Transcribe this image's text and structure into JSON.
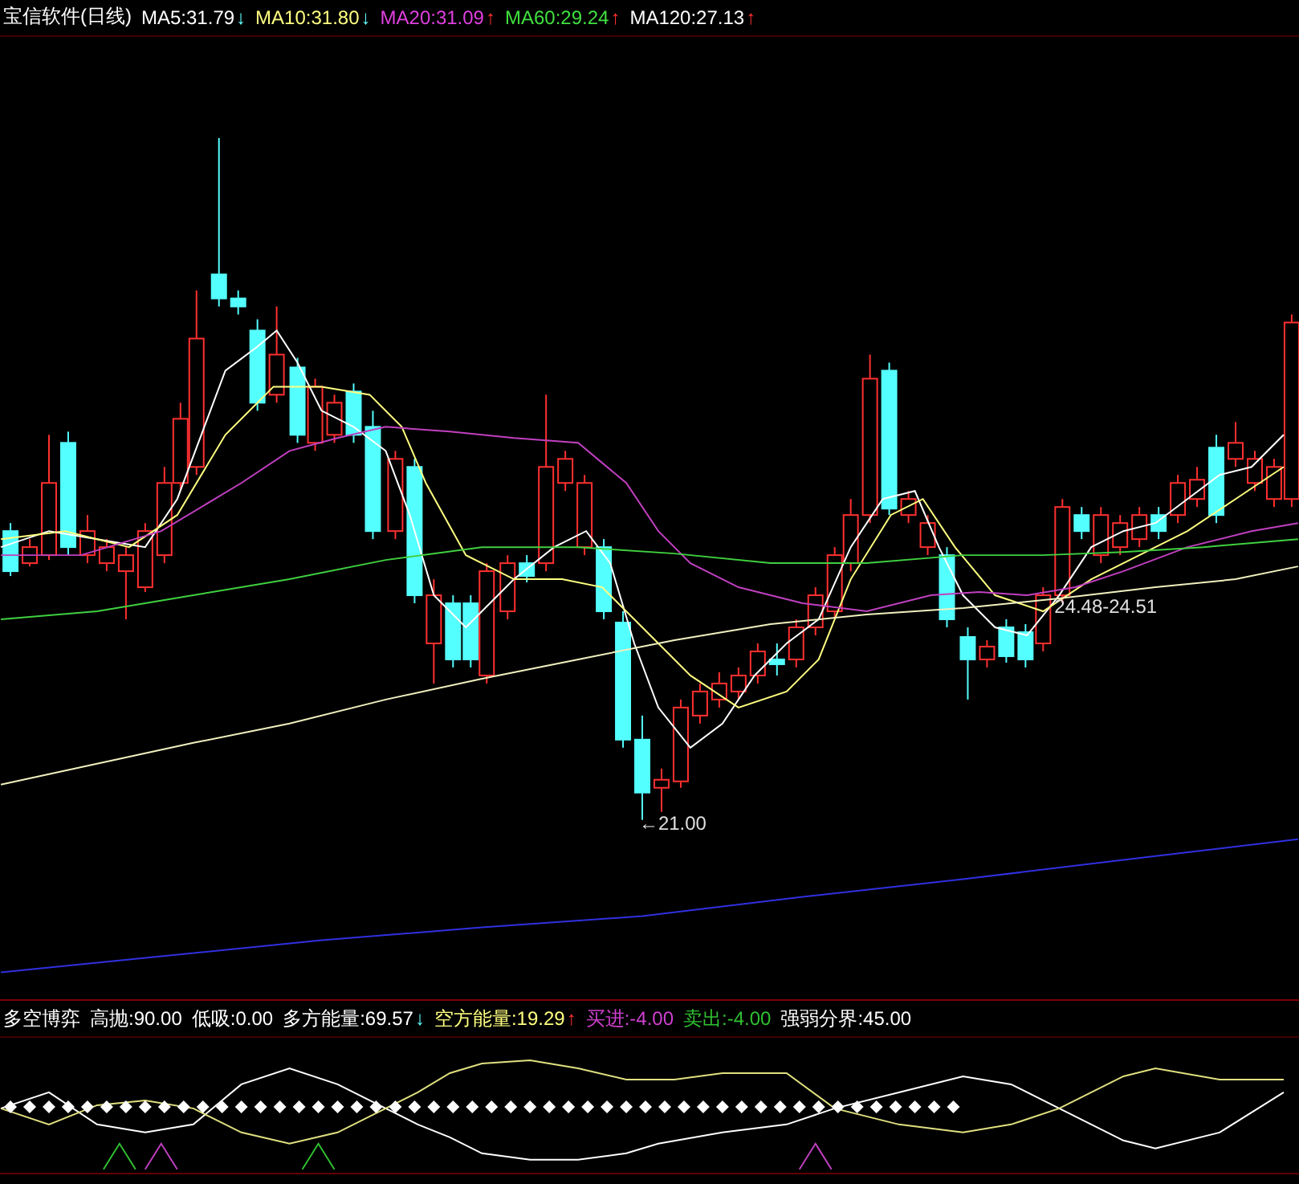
{
  "chart_header": {
    "title": "宝信软件(日线)",
    "indicators": [
      {
        "label": "MA5:31.79",
        "color": "#ffffff",
        "arrow": "↓",
        "rising": false
      },
      {
        "label": "MA10:31.80",
        "color": "#ffff80",
        "arrow": "↓",
        "rising": false
      },
      {
        "label": "MA20:31.09",
        "color": "#e040e0",
        "arrow": "↑",
        "rising": true
      },
      {
        "label": "MA60:29.24",
        "color": "#40e040",
        "arrow": "↑",
        "rising": true
      },
      {
        "label": "MA120:27.13",
        "color": "#ffffff",
        "arrow": "↑",
        "rising": true
      }
    ]
  },
  "price_labels": [
    {
      "text": "←21.00"
    },
    {
      "text": "24.48-24.51"
    }
  ],
  "indicator_header": {
    "title": "多空博弈",
    "indicators": [
      {
        "label": "高抛:90.00",
        "color": "#ffffff"
      },
      {
        "label": "低吸:0.00",
        "color": "#ffffff"
      },
      {
        "label": "多方能量:69.57",
        "color": "#ffffff",
        "arrow": "↓",
        "rising": false
      },
      {
        "label": "空方能量:19.29",
        "color": "#ffff80",
        "arrow": "↑",
        "rising": true
      },
      {
        "label": "买进:-4.00",
        "color": "#d040d0"
      },
      {
        "label": "卖出:-4.00",
        "color": "#30c030"
      },
      {
        "label": "强弱分界:45.00",
        "color": "#ffffff"
      }
    ]
  }
}
